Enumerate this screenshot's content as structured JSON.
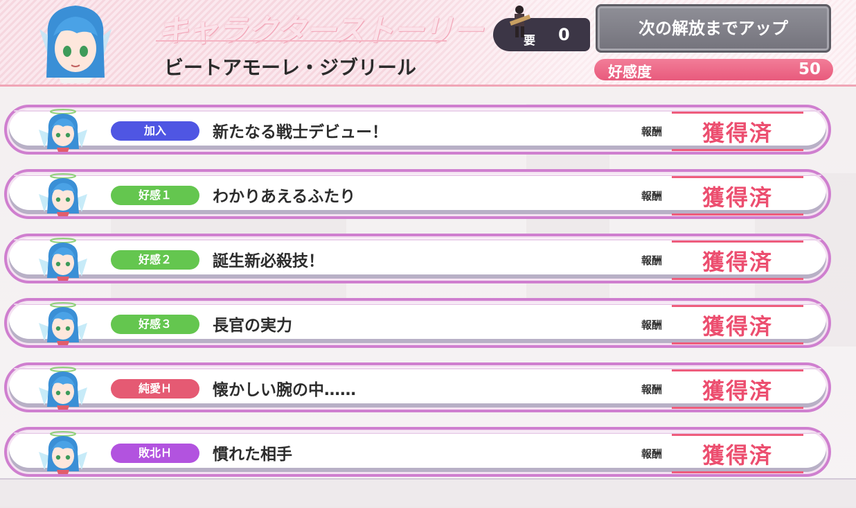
{
  "header": {
    "title": "キャラクターストーリー",
    "character_name": "ビートアモーレ・ジブリール",
    "requirement": {
      "label": "要",
      "value": "0"
    },
    "unlock_button": "次の解放までアップ",
    "affinity": {
      "label": "好感度",
      "value": "50"
    }
  },
  "stories": [
    {
      "tag": "加入",
      "tag_color": "#4f56e3",
      "title": "新たなる戦士デビュー！",
      "reward_label": "報酬",
      "reward_status": "獲得済"
    },
    {
      "tag": "好感１",
      "tag_color": "#64c64f",
      "title": "わかりあえるふたり",
      "reward_label": "報酬",
      "reward_status": "獲得済"
    },
    {
      "tag": "好感２",
      "tag_color": "#64c64f",
      "title": "誕生新必殺技！",
      "reward_label": "報酬",
      "reward_status": "獲得済"
    },
    {
      "tag": "好感３",
      "tag_color": "#64c64f",
      "title": "長官の実力",
      "reward_label": "報酬",
      "reward_status": "獲得済"
    },
    {
      "tag": "純愛Ｈ",
      "tag_color": "#e55a73",
      "title": "懐かしい腕の中……",
      "reward_label": "報酬",
      "reward_status": "獲得済"
    },
    {
      "tag": "敗北Ｈ",
      "tag_color": "#b253df",
      "title": "慣れた相手",
      "reward_label": "報酬",
      "reward_status": "獲得済"
    }
  ],
  "colors": {
    "accent_pink": "#ec4e6f",
    "row_border": "#cf7fcf",
    "button_gray": "#74737c"
  }
}
